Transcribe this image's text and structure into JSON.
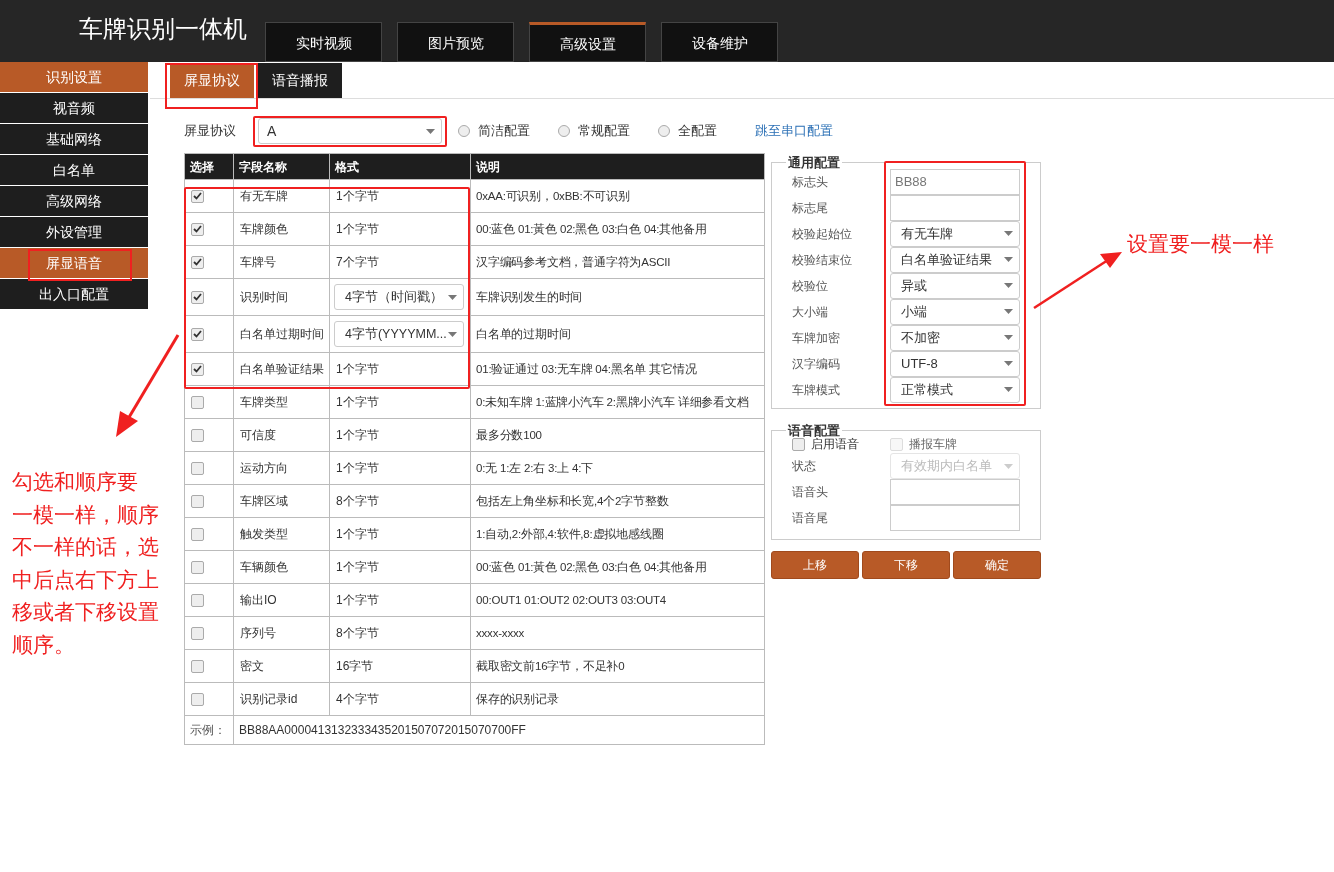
{
  "app_title": "车牌识别一体机",
  "top_nav": [
    {
      "label": "实时视频",
      "selected": false
    },
    {
      "label": "图片预览",
      "selected": false
    },
    {
      "label": "高级设置",
      "selected": true
    },
    {
      "label": "设备维护",
      "selected": false
    }
  ],
  "sidebar": [
    {
      "label": "识别设置",
      "selected": true
    },
    {
      "label": "视音频",
      "selected": false
    },
    {
      "label": "基础网络",
      "selected": false
    },
    {
      "label": "白名单",
      "selected": false
    },
    {
      "label": "高级网络",
      "selected": false
    },
    {
      "label": "外设管理",
      "selected": false
    },
    {
      "label": "屏显语音",
      "selected": true
    },
    {
      "label": "出入口配置",
      "selected": false
    }
  ],
  "sub_tabs": [
    {
      "label": "屏显协议",
      "selected": true
    },
    {
      "label": "语音播报",
      "selected": false
    }
  ],
  "protocol": {
    "label": "屏显协议",
    "value": "A"
  },
  "config_options": [
    {
      "label": "简洁配置",
      "selected": false
    },
    {
      "label": "常规配置",
      "selected": false
    },
    {
      "label": "全配置",
      "selected": false
    }
  ],
  "serial_link": "跳至串口配置",
  "table": {
    "columns": [
      "选择",
      "字段名称",
      "格式",
      "说明"
    ],
    "rows": [
      {
        "checked": true,
        "field": "有无车牌",
        "format": "1个字节",
        "kind": "text",
        "description": "0xAA:可识别，0xBB:不可识别"
      },
      {
        "checked": true,
        "field": "车牌颜色",
        "format": "1个字节",
        "kind": "text",
        "description": "00:蓝色 01:黃色 02:黑色 03:白色 04:其他备用"
      },
      {
        "checked": true,
        "field": "车牌号",
        "format": "7个字节",
        "kind": "text",
        "description": "汉字编码参考文档，普通字符为ASCII"
      },
      {
        "checked": true,
        "field": "识别时间",
        "format": "4字节（时间戳）",
        "kind": "select",
        "description": "车牌识别发生的时间"
      },
      {
        "checked": true,
        "field": "白名单过期时间",
        "format": "4字节(YYYYMM...",
        "kind": "select",
        "description": "白名单的过期时间"
      },
      {
        "checked": true,
        "field": "白名单验证结果",
        "format": "1个字节",
        "kind": "text",
        "description": "01:验证通过 03:无车牌 04:黑名单 其它情况"
      },
      {
        "checked": false,
        "field": "车牌类型",
        "format": "1个字节",
        "kind": "text",
        "description": "0:未知车牌 1:蓝牌小汽车 2:黑牌小汽车 详细参看文档"
      },
      {
        "checked": false,
        "field": "可信度",
        "format": "1个字节",
        "kind": "text",
        "description": "最多分数100"
      },
      {
        "checked": false,
        "field": "运动方向",
        "format": "1个字节",
        "kind": "text",
        "description": "0:无 1:左 2:右 3:上 4:下"
      },
      {
        "checked": false,
        "field": "车牌区域",
        "format": "8个字节",
        "kind": "text",
        "description": "包括左上角坐标和长宽,4个2字节整数"
      },
      {
        "checked": false,
        "field": "触发类型",
        "format": "1个字节",
        "kind": "text",
        "description": "1:自动,2:外部,4:软件,8:虚拟地感线圈"
      },
      {
        "checked": false,
        "field": "车辆颜色",
        "format": "1个字节",
        "kind": "text",
        "description": "00:蓝色 01:黃色 02:黑色 03:白色 04:其他备用"
      },
      {
        "checked": false,
        "field": "输出IO",
        "format": "1个字节",
        "kind": "text",
        "description": "00:OUT1 01:OUT2 02:OUT3 03:OUT4"
      },
      {
        "checked": false,
        "field": "序列号",
        "format": "8个字节",
        "kind": "text",
        "description": "xxxx-xxxx"
      },
      {
        "checked": false,
        "field": "密文",
        "format": "16字节",
        "kind": "text",
        "description": "截取密文前16字节，不足补0"
      },
      {
        "checked": false,
        "field": "识别记录id",
        "format": "4个字节",
        "kind": "text",
        "description": "保存的识别记录"
      }
    ],
    "example": {
      "label": "示例：",
      "value": "BB88AA0000413132333435201507072015070700FF"
    }
  },
  "general_config": {
    "title": "通用配置",
    "fields": [
      {
        "label": "标志头",
        "kind": "input",
        "value": "BB88"
      },
      {
        "label": "标志尾",
        "kind": "input"
      },
      {
        "label": "校验起始位",
        "kind": "select",
        "value": "有无车牌"
      },
      {
        "label": "校验结束位",
        "kind": "select",
        "value": "白名单验证结果"
      },
      {
        "label": "校验位",
        "kind": "select",
        "value": "异或"
      },
      {
        "label": "大小端",
        "kind": "select",
        "value": "小端"
      },
      {
        "label": "车牌加密",
        "kind": "select",
        "value": "不加密"
      },
      {
        "label": "汉字编码",
        "kind": "select",
        "value": "UTF-8"
      },
      {
        "label": "车牌模式",
        "kind": "select",
        "value": "正常模式"
      }
    ]
  },
  "voice_config": {
    "title": "语音配置",
    "checks": [
      {
        "label": "启用语音",
        "checked": false,
        "disabled": false
      },
      {
        "label": "播报车牌",
        "checked": false,
        "disabled": true
      }
    ],
    "fields": [
      {
        "label": "状态",
        "kind": "select",
        "value": "有效期内白名单",
        "disabled": true
      },
      {
        "label": "语音头",
        "kind": "input",
        "disabled": false
      },
      {
        "label": "语音尾",
        "kind": "input",
        "disabled": false
      }
    ]
  },
  "buttons": [
    "上移",
    "下移",
    "确定"
  ],
  "annotations": {
    "left_note": [
      "勾选和顺序要",
      "一模一样，顺序",
      "不一样的话，选",
      "中后点右下方上",
      "移或者下移设置",
      "顺序。"
    ],
    "right_note": "设置要一模一样"
  }
}
